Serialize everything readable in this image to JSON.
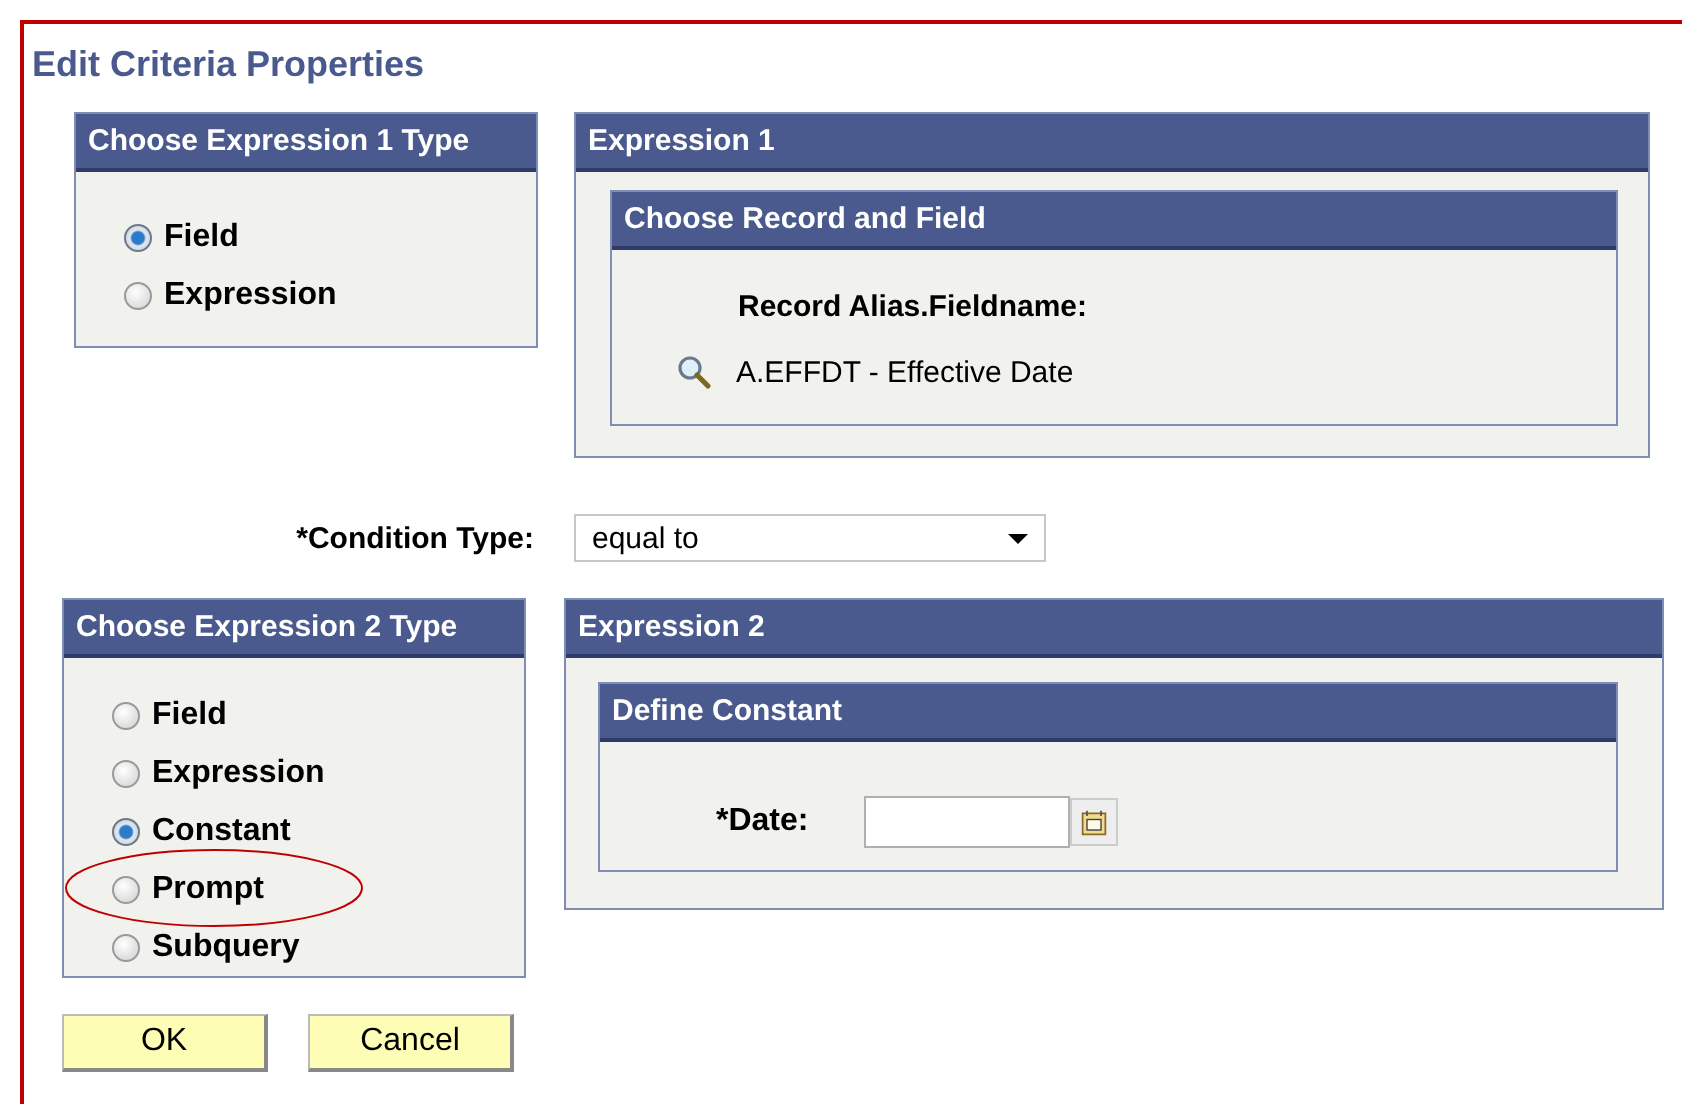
{
  "title": "Edit Criteria Properties",
  "expression1_type": {
    "heading": "Choose Expression 1 Type",
    "options": [
      {
        "label": "Field",
        "selected": true
      },
      {
        "label": "Expression",
        "selected": false
      }
    ]
  },
  "expression1": {
    "heading": "Expression 1",
    "record_field": {
      "heading": "Choose Record and Field",
      "label": "Record Alias.Fieldname:",
      "value": "A.EFFDT - Effective Date"
    }
  },
  "condition_type": {
    "label": "*Condition Type:",
    "value": "equal to"
  },
  "expression2_type": {
    "heading": "Choose Expression 2 Type",
    "options": [
      {
        "label": "Field",
        "selected": false
      },
      {
        "label": "Expression",
        "selected": false
      },
      {
        "label": "Constant",
        "selected": true
      },
      {
        "label": "Prompt",
        "selected": false,
        "circled": true
      },
      {
        "label": "Subquery",
        "selected": false
      }
    ]
  },
  "expression2": {
    "heading": "Expression 2",
    "constant": {
      "heading": "Define Constant",
      "label": "*Date:"
    }
  },
  "buttons": [
    "OK",
    "Cancel"
  ]
}
